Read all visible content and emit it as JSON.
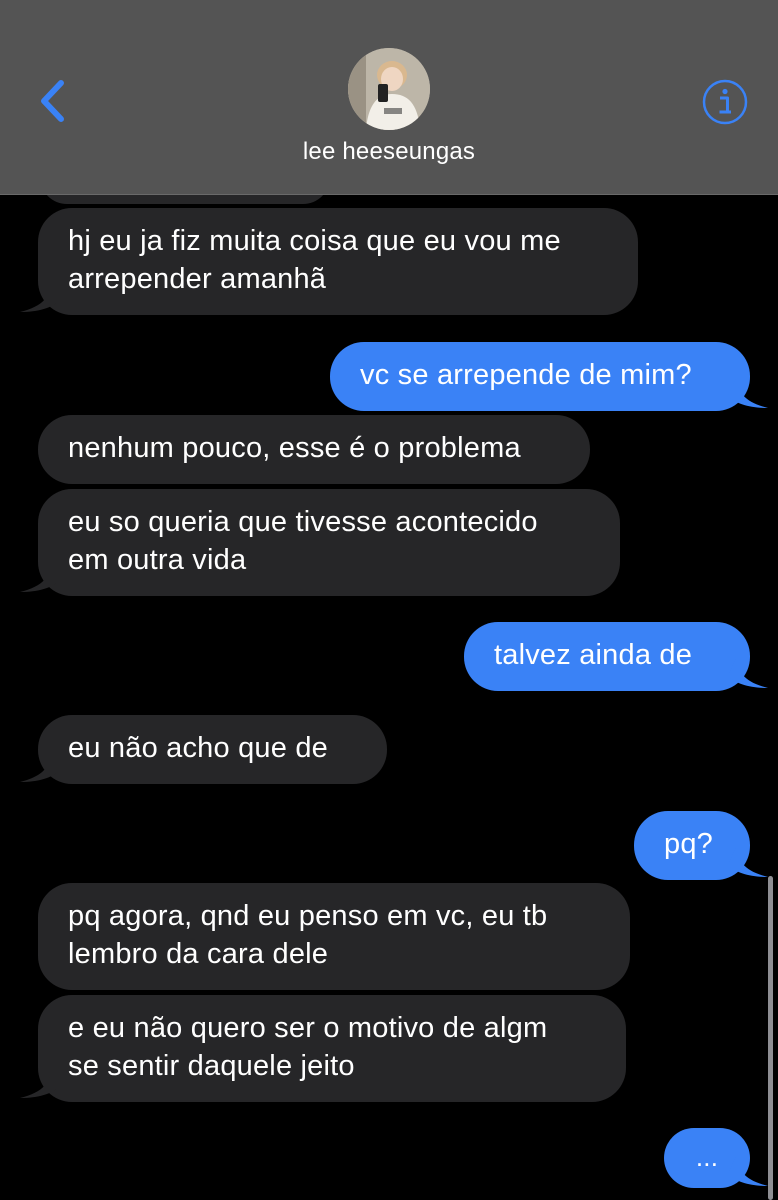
{
  "header": {
    "contact_name": "lee heeseungas",
    "back_icon": "chevron-left-icon",
    "info_icon": "info-circle-icon",
    "accent_color": "#3a82f6"
  },
  "messages": [
    {
      "direction": "received",
      "text": "hj eu ja fiz muita coisa que eu vou me\narrepender amanhã"
    },
    {
      "direction": "sent",
      "text": "vc se arrepende de mim?"
    },
    {
      "direction": "received",
      "text": "nenhum pouco, esse é o problema"
    },
    {
      "direction": "received",
      "text": "eu so queria que tivesse acontecido\nem outra vida"
    },
    {
      "direction": "sent",
      "text": "talvez ainda de"
    },
    {
      "direction": "received",
      "text": "eu não acho que de"
    },
    {
      "direction": "sent",
      "text": "pq?"
    },
    {
      "direction": "received",
      "text": "pq agora, qnd eu penso em vc, eu tb\nlembro da cara dele"
    },
    {
      "direction": "received",
      "text": "e eu não quero ser o motivo de algm\nse sentir daquele jeito"
    },
    {
      "direction": "sent",
      "text": "..."
    }
  ],
  "colors": {
    "received_bubble": "#262628",
    "sent_bubble": "#3a82f6",
    "header_bg": "#545454",
    "background": "#000000"
  }
}
